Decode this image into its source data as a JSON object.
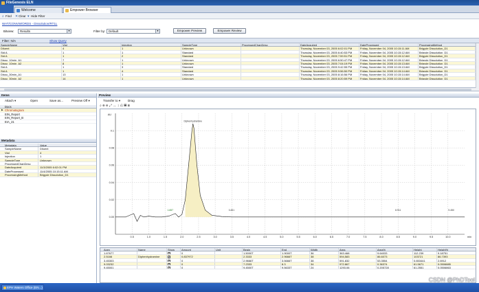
{
  "window": {
    "title": "FileGenesis ELN"
  },
  "tabs": [
    {
      "label": "Welcome",
      "color": "#3f7fd1"
    },
    {
      "label": "Empower Browser",
      "color": "#e8b84a"
    }
  ],
  "toolbar": {
    "find": "Find",
    "clear": "Clear",
    "hide_filter": "Hide Filter"
  },
  "breadcrumb": "WAT/CONVW/ORDS - Dissolution/RT1L",
  "filter_row": {
    "bitview_label": "Bitview:",
    "bitview_value": "Results",
    "filter_label": "Filter by:",
    "filter_value": "Default",
    "preview_button": "Empower Preview",
    "review_button": "Empower Review"
  },
  "filter_bar": {
    "label": "Filter: N/A",
    "show_queries": "Show Query"
  },
  "results": {
    "columns": [
      "SampleName",
      "Vial",
      "Injection",
      "SampleType",
      "ProcessedChanDesc",
      "DateAcquired",
      "DateProcessed",
      "ProcessingMethod"
    ],
    "rows": [
      [
        "Diluent",
        "4",
        "1",
        "Unknown",
        "",
        "Thursday, November 03, 2005 6:02:01 PM",
        "Friday, November 04, 2005 10:15:11 AM",
        "Brigyde Dissolution_D1"
      ],
      [
        "Std A",
        "1",
        "1",
        "Standard",
        "",
        "Thursday, November 03, 2005 6:40:53 PM",
        "Friday, November 04, 2005 10:15:12 AM",
        "Brigyde Dissolution_D1"
      ],
      [
        "Std A",
        "1",
        "2",
        "Standard",
        "",
        "Thursday, November 03, 2005 7:59:51 PM",
        "Friday, November 04, 2005 10:15:12 AM",
        "Brigyde Dissolution_D1"
      ],
      [
        "Disso_10min_A1",
        "7",
        "1",
        "Unknown",
        "",
        "Thursday, November 03, 2005 6:50:47 PM",
        "Friday, November 04, 2005 10:15:12 AM",
        "Brigyde Dissolution_D1"
      ],
      [
        "Disso_10min_A2",
        "8",
        "1",
        "Unknown",
        "",
        "Thursday, November 03, 2005 7:04:19 PM",
        "Friday, November 04, 2005 10:15:13 AM",
        "Brigyde Dissolution_D1"
      ],
      [
        "Std A",
        "1",
        "3",
        "Standard",
        "",
        "Thursday, November 03, 2005 9:42:55 PM",
        "Friday, November 04, 2005 10:15:13 AM",
        "Brigyde Dissolution_D1"
      ],
      [
        "Std A",
        "1",
        "4",
        "Standard",
        "",
        "Thursday, November 03, 2005 9:56:50 PM",
        "Friday, November 04, 2005 10:15:14 AM",
        "Brigyde Dissolution_D1"
      ],
      [
        "Disso_30min_A1",
        "13",
        "1",
        "Unknown",
        "",
        "Thursday, November 03, 2005 8:16:56 PM",
        "Friday, November 04, 2005 10:15:14 AM",
        "Brigyde Dissolution_D1"
      ],
      [
        "Disso_30min_A2",
        "14",
        "1",
        "Unknown",
        "",
        "Thursday, November 03, 2005 8:20:59 PM",
        "Friday, November 04, 2005 10:15:14 AM",
        "Brigyde Dissolution_D1"
      ]
    ]
  },
  "items_panel": {
    "title": "Items",
    "attach": "Attach",
    "open": "Open",
    "save_as": "Save as...",
    "preview_off": "Preview Off",
    "header": "Docs",
    "items": [
      "Chromatogram",
      "EIN_Report",
      "EIN_Report_B",
      "EIA_21"
    ]
  },
  "metadata_panel": {
    "title": "Metadata",
    "columns": [
      "Metadata",
      "Value"
    ],
    "rows": [
      [
        "SampleName",
        "Diluent"
      ],
      [
        "Vial",
        "4"
      ],
      [
        "Injection",
        "1"
      ],
      [
        "SampleType",
        "Unknown"
      ],
      [
        "ProcessedChanDesc",
        ""
      ],
      [
        "DateAcquired",
        "11/3/2005 6:02:01 PM"
      ],
      [
        "DateProcessed",
        "11/4/2005 10:15:11 AM"
      ],
      [
        "ProcessingMethod",
        "Brigyde Dissolution_D1"
      ]
    ]
  },
  "preview_panel": {
    "title": "Preview",
    "transfer": "Transfer to",
    "drag": "Drag"
  },
  "chart_data": {
    "type": "line",
    "title": "",
    "xlabel": "min",
    "ylabel": "AU",
    "xlim": [
      0,
      10.5
    ],
    "ylim": [
      -0.02,
      0.12
    ],
    "yticks": [
      {
        "v": 0.1,
        "label": "0.1"
      },
      {
        "v": 0.08,
        "label": "0.08"
      },
      {
        "v": 0.06,
        "label": "0.06"
      },
      {
        "v": 0.04,
        "label": "0.04"
      },
      {
        "v": 0.02,
        "label": "0.02"
      },
      {
        "v": 0,
        "label": "0.00"
      }
    ],
    "xticks": [
      {
        "v": 0.5,
        "label": "0.5"
      },
      {
        "v": 1,
        "label": "1.0"
      },
      {
        "v": 1.5,
        "label": "1.5"
      },
      {
        "v": 2,
        "label": "2.0"
      },
      {
        "v": 2.5,
        "label": "2.5"
      },
      {
        "v": 3,
        "label": "3.0"
      },
      {
        "v": 3.5,
        "label": "3.5"
      },
      {
        "v": 4,
        "label": "4.0"
      },
      {
        "v": 4.5,
        "label": "4.5"
      },
      {
        "v": 5,
        "label": "5.0"
      },
      {
        "v": 5.5,
        "label": "5.5"
      },
      {
        "v": 6,
        "label": "6.0"
      },
      {
        "v": 6.5,
        "label": "6.5"
      },
      {
        "v": 7,
        "label": "7.0"
      },
      {
        "v": 7.5,
        "label": "7.5"
      },
      {
        "v": 8,
        "label": "8.0"
      },
      {
        "v": 8.5,
        "label": "8.5"
      },
      {
        "v": 9,
        "label": "9.0"
      },
      {
        "v": 9.5,
        "label": "9.5"
      },
      {
        "v": 10,
        "label": "10.0"
      }
    ],
    "x": [
      0,
      0.3,
      0.55,
      0.65,
      0.75,
      0.85,
      1.0,
      1.2,
      1.4,
      1.6,
      1.8,
      1.9,
      2.0,
      2.1,
      2.2,
      2.3,
      2.33,
      2.36,
      2.45,
      2.55,
      2.7,
      2.9,
      3.2,
      3.5,
      4.0,
      4.5,
      5.0,
      6.0,
      7.0,
      8.0,
      8.5,
      9.0,
      9.5,
      10.0,
      10.5
    ],
    "y": [
      0,
      0,
      0.004,
      -0.005,
      0.002,
      0.0,
      0.001,
      0,
      0.0,
      0.001,
      0.004,
      0.0,
      0.003,
      0.02,
      0.06,
      0.1,
      0.108,
      0.103,
      0.06,
      0.025,
      0.008,
      0.002,
      0.0005,
      0,
      0,
      0,
      0,
      0,
      0,
      0,
      0,
      0,
      0,
      0,
      0
    ],
    "annotations": [
      {
        "x": 2.33,
        "y": 0.109,
        "label": "Diphenhydramine"
      },
      {
        "x": 1.65,
        "y": 0.006,
        "label": "1.657"
      },
      {
        "x": 3.49,
        "y": 0.006,
        "label": "3.451"
      },
      {
        "x": 8.5,
        "y": 0.006,
        "label": "8.911"
      },
      {
        "x": 10.1,
        "y": 0.006,
        "label": "9.450"
      }
    ]
  },
  "peaks": {
    "columns": [
      "Apex",
      "Name",
      "Show",
      "Amount",
      "Unit",
      "Begin",
      "End",
      "Width",
      "Area",
      "Area%",
      "Height",
      "Height%"
    ],
    "rows": [
      [
        "1.67677",
        "",
        "true",
        "0",
        "",
        "1.5000T",
        "1.9000T",
        "36",
        "363,468",
        "9.64033",
        "112,239",
        "9.18751"
      ],
      [
        "2.5166",
        "Diphenhydramine",
        "true",
        "0.837972",
        "",
        "2.3333",
        "2.9666T",
        "38",
        "594,583",
        "86.6073",
        "103721",
        "86.7393"
      ],
      [
        "3.45303",
        "",
        "true",
        "0",
        "",
        "2.9666T",
        "3.5666T",
        "38",
        "591,832",
        "53.3554",
        "0.653441",
        "2.6912"
      ],
      [
        "9.03232",
        "",
        "true",
        "0",
        "",
        "7.2333",
        "8.3",
        "34",
        "972.867",
        "0.36374",
        "61.5671",
        "0.0506885"
      ],
      [
        "9.45001",
        "",
        "true",
        "0",
        "",
        "9.4500T",
        "9.5633T",
        "24",
        "1293.06",
        "0.205728",
        "61.2551",
        "0.0506863"
      ]
    ]
  },
  "taskbar": {
    "start_label": "EPH Waters Office (EN...)"
  },
  "watermark": "CSDN @PhDTool",
  "colors": {
    "accent": "#2d62b1",
    "row_highlight": "#fbf7d5",
    "peak_fill": "#f6efc4",
    "trace": "#1f1f1f"
  }
}
